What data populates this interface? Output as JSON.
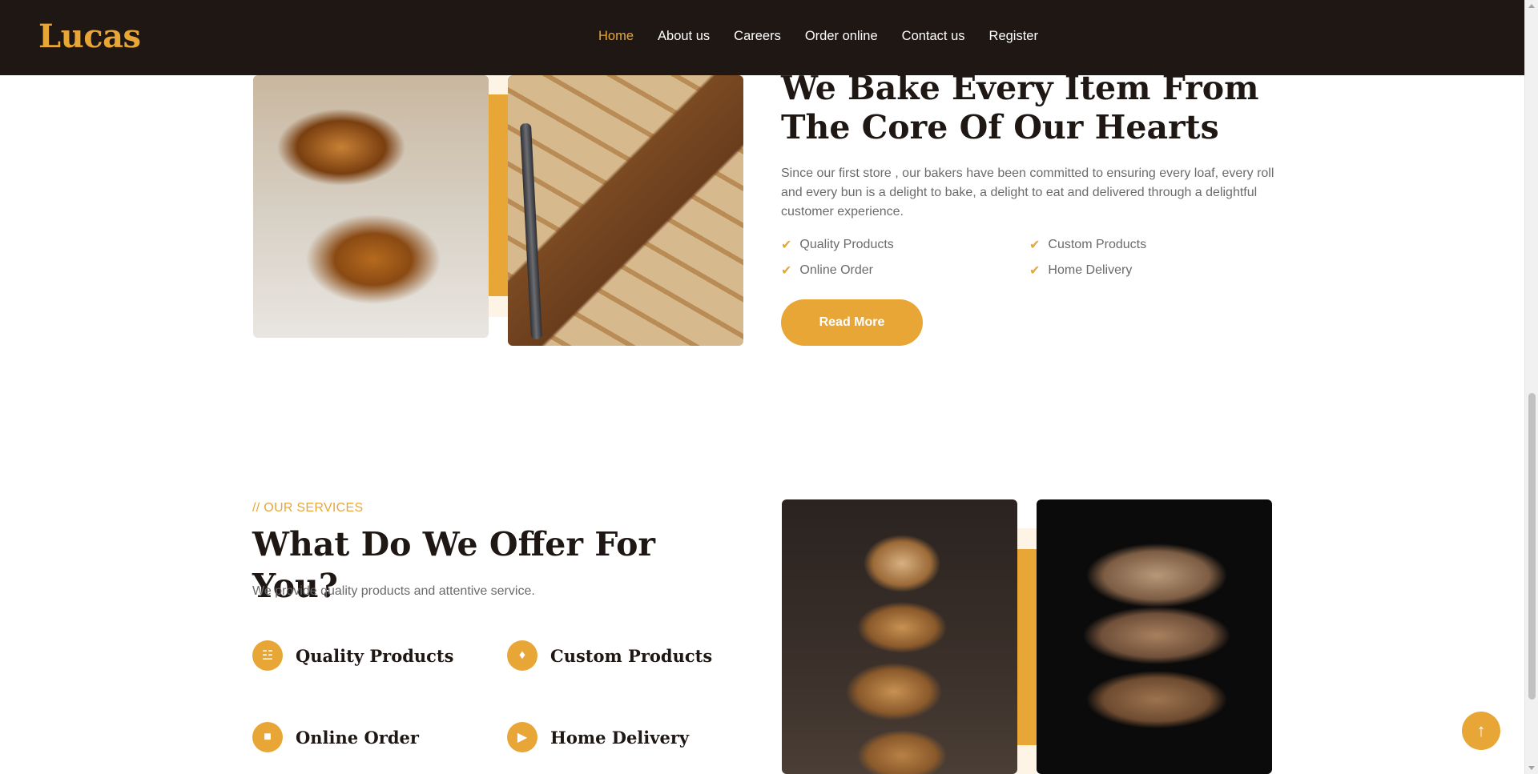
{
  "brand": {
    "name": "Lucas"
  },
  "nav": {
    "items": [
      "Home",
      "About us",
      "Careers",
      "Order online",
      "Contact us",
      "Register"
    ],
    "active": "Home"
  },
  "about": {
    "title": "We Bake Every Item From The Core Of Our Hearts",
    "text": "Since our first store , our bakers have been committed to ensuring every loaf, every roll and every bun is a delight to bake, a delight to eat and delivered through a delightful customer experience.",
    "checks": [
      "Quality Products",
      "Custom Products",
      "Online Order",
      "Home Delivery"
    ],
    "button": "Read More"
  },
  "services": {
    "tag": "// OUR SERVICES",
    "title": "What Do We Offer For You?",
    "subtitle": "We provide quality products and attentive service.",
    "items": [
      {
        "label": "Quality Products",
        "icon": "bread-icon"
      },
      {
        "label": "Custom Products",
        "icon": "cake-icon"
      },
      {
        "label": "Online Order",
        "icon": "cart-icon"
      },
      {
        "label": "Home Delivery",
        "icon": "truck-icon"
      }
    ]
  },
  "colors": {
    "accent": "#e8a637",
    "navbar": "#1e1714",
    "heading": "#1e1714",
    "text": "#6b6b6b"
  }
}
